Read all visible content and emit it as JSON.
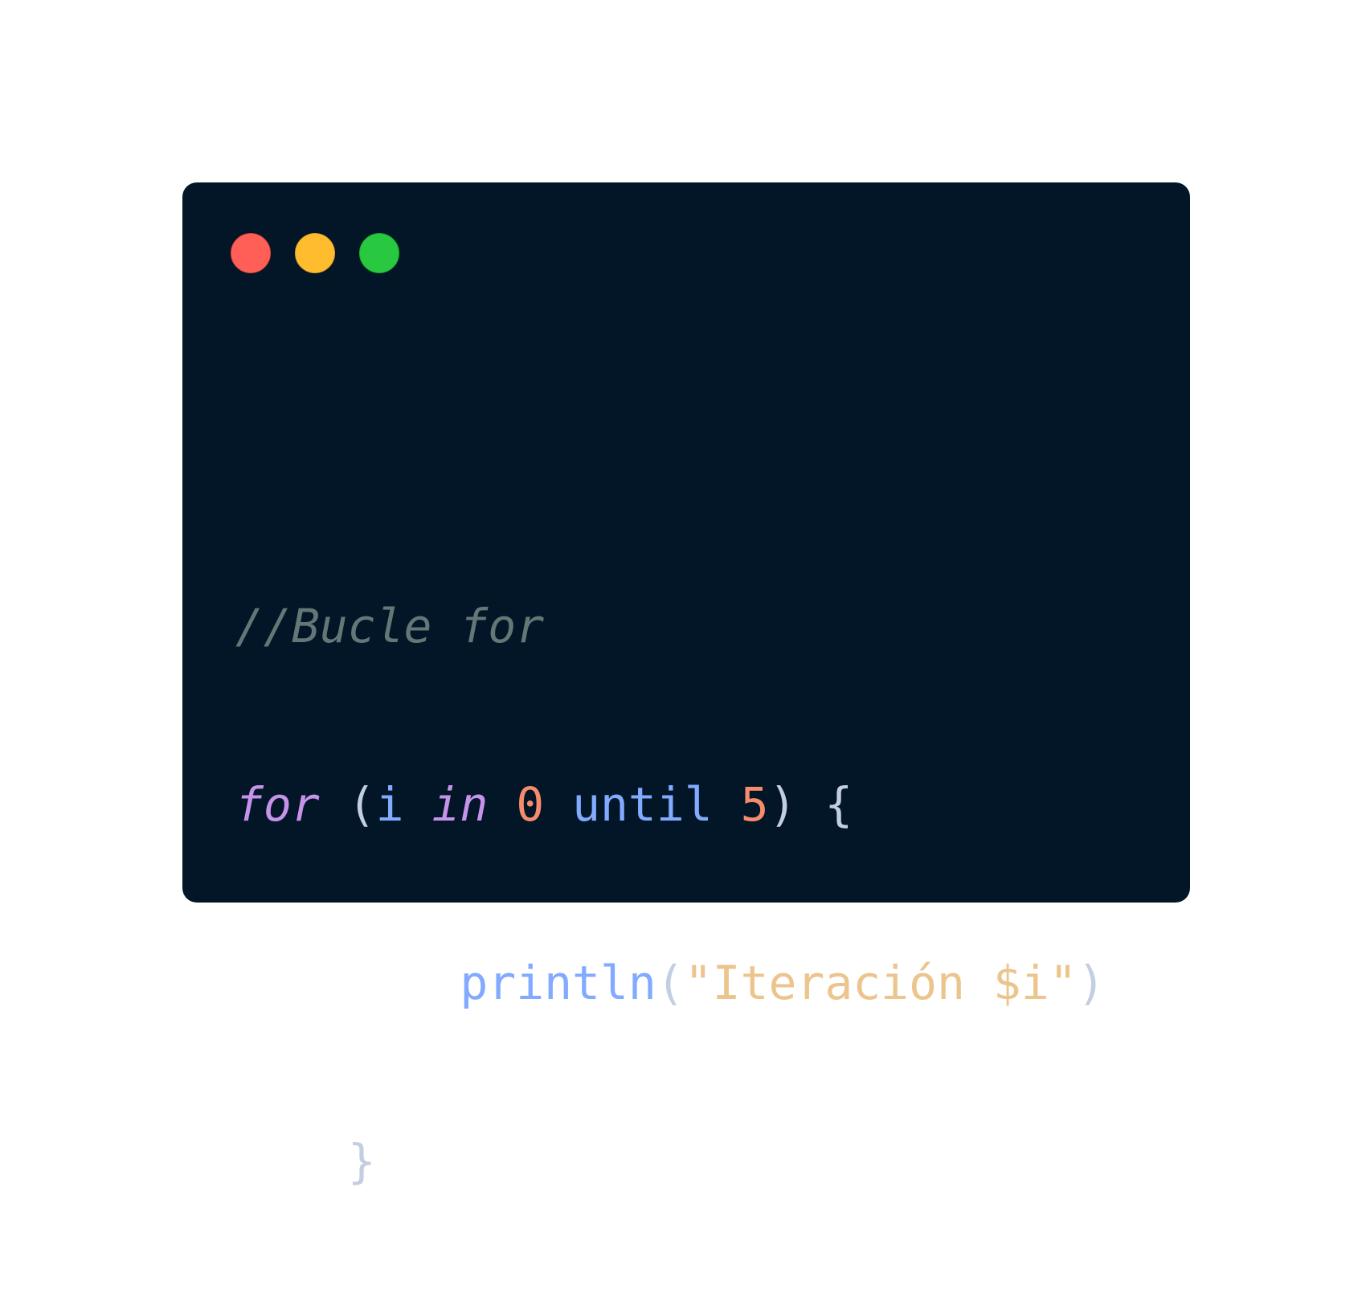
{
  "window": {
    "controls": {
      "close_color": "#ff5f57",
      "minimize_color": "#febc2e",
      "maximize_color": "#28c840"
    }
  },
  "code": {
    "line1": {
      "comment": "//Bucle for"
    },
    "line2": {
      "kw_for": "for",
      "sp1": " ",
      "paren_open": "(",
      "var_i": "i",
      "sp2": " ",
      "kw_in": "in",
      "sp3": " ",
      "num_start": "0",
      "sp4": " ",
      "until": "until",
      "sp5": " ",
      "num_end": "5",
      "paren_close": ")",
      "sp6": " ",
      "brace_open": "{"
    },
    "line3": {
      "indent": "        ",
      "fn_name": "println",
      "paren_open": "(",
      "string": "\"Iteración $i\"",
      "paren_close": ")"
    },
    "line4": {
      "indent": "    ",
      "brace_close": "}"
    }
  }
}
